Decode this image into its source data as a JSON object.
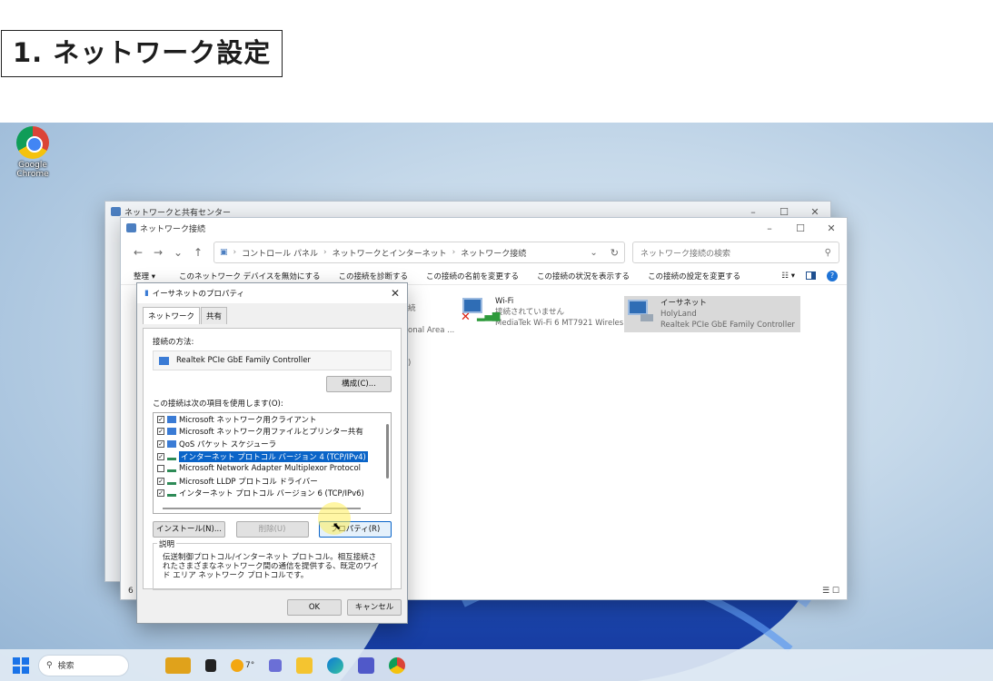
{
  "heading": "1. ネットワーク設定",
  "desktop": {
    "icon_label": "Google Chrome"
  },
  "back_window": {
    "title": "ネットワークと共有センター"
  },
  "main_window": {
    "title": "ネットワーク接続",
    "breadcrumbs": [
      "コントロール パネル",
      "ネットワークとインターネット",
      "ネットワーク接続"
    ],
    "search_placeholder": "ネットワーク接続の検索",
    "commands": [
      "整理 ▾",
      "このネットワーク デバイスを無効にする",
      "この接続を診断する",
      "この接続の名前を変更する",
      "この接続の状況を表示する",
      "この接続の設定を変更する"
    ],
    "adapters": [
      {
        "name": "Wi-Fi",
        "status": "接続されていません",
        "device": "MediaTek Wi-Fi 6 MT7921 Wireles..."
      },
      {
        "name": "イーサネット",
        "status": "HolyLand",
        "device": "Realtek PCIe GbE Family Controller"
      }
    ],
    "partial_adapter": {
      "line1": "続",
      "line2": "onal Area ...",
      "line3": ")"
    },
    "status_left": "6"
  },
  "dialog": {
    "title": "イーサネットのプロパティ",
    "tabs": [
      "ネットワーク",
      "共有"
    ],
    "connect_using_label": "接続の方法:",
    "adapter_name": "Realtek PCIe GbE Family Controller",
    "configure_button": "構成(C)...",
    "items_label": "この接続は次の項目を使用します(O):",
    "items": [
      {
        "label": "Microsoft ネットワーク用クライアント",
        "checked": true,
        "icon": "net"
      },
      {
        "label": "Microsoft ネットワーク用ファイルとプリンター共有",
        "checked": true,
        "icon": "net"
      },
      {
        "label": "QoS パケット スケジューラ",
        "checked": true,
        "icon": "net"
      },
      {
        "label": "インターネット プロトコル バージョン 4 (TCP/IPv4)",
        "checked": true,
        "icon": "proto",
        "selected": true
      },
      {
        "label": "Microsoft Network Adapter Multiplexor Protocol",
        "checked": false,
        "icon": "proto"
      },
      {
        "label": "Microsoft LLDP プロトコル ドライバー",
        "checked": true,
        "icon": "proto"
      },
      {
        "label": "インターネット プロトコル バージョン 6 (TCP/IPv6)",
        "checked": true,
        "icon": "proto"
      }
    ],
    "install_button": "インストール(N)...",
    "uninstall_button": "削除(U)",
    "properties_button": "プロパティ(R)",
    "description_label": "説明",
    "description_text": "伝送制御プロトコル/インターネット プロトコル。相互接続されたさまざまなネットワーク間の通信を提供する、既定のワイド エリア ネットワーク プロトコルです。",
    "ok_button": "OK",
    "cancel_button": "キャンセル"
  },
  "taskbar": {
    "search_label": "検索",
    "weather": "7°"
  }
}
